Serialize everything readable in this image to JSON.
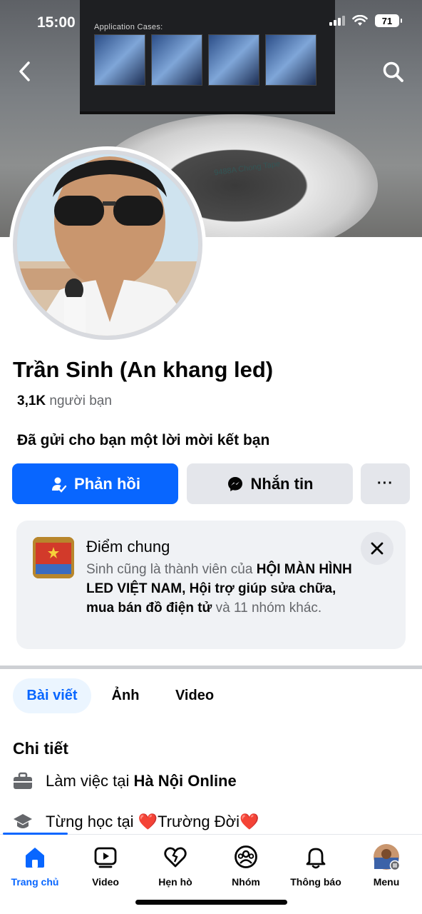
{
  "status_bar": {
    "time": "15:00",
    "battery": "71"
  },
  "cover": {
    "box_label": "Application Cases:",
    "tape_label": "9488A  Chong Tape"
  },
  "profile": {
    "name": "Trần Sinh (An khang led)",
    "friends_count": "3,1K",
    "friends_label": "người bạn",
    "invite_text": "Đã gửi cho bạn một lời mời kết bạn"
  },
  "actions": {
    "respond_label": "Phản hồi",
    "message_label": "Nhắn tin",
    "more_label": "···"
  },
  "mutual": {
    "title": "Điểm chung",
    "text_prefix": "Sinh cũng là thành viên của ",
    "group1": "HỘI MÀN HÌNH LED VIỆT NAM",
    "sep": ", ",
    "group2": "Hội trợ giúp sửa chữa, mua bán đồ điện tử",
    "text_suffix": " và 11 nhóm khác."
  },
  "tabs": [
    "Bài viết",
    "Ảnh",
    "Video"
  ],
  "details": {
    "title": "Chi tiết",
    "work_prefix": "Làm việc tại ",
    "work_place": "Hà Nội Online",
    "study_prefix": "Từng học tại ",
    "study_place": "❤️Trường Đời❤️"
  },
  "bottom_nav": {
    "items": [
      {
        "label": "Trang chủ",
        "icon": "home-icon"
      },
      {
        "label": "Video",
        "icon": "video-icon"
      },
      {
        "label": "Hẹn hò",
        "icon": "dating-icon"
      },
      {
        "label": "Nhóm",
        "icon": "groups-icon"
      },
      {
        "label": "Thông báo",
        "icon": "bell-icon"
      },
      {
        "label": "Menu",
        "icon": "menu-avatar"
      }
    ]
  },
  "colors": {
    "primary": "#0866ff",
    "secondary_bg": "#e4e6eb",
    "card_bg": "#f0f2f5",
    "muted_text": "#65676b"
  }
}
